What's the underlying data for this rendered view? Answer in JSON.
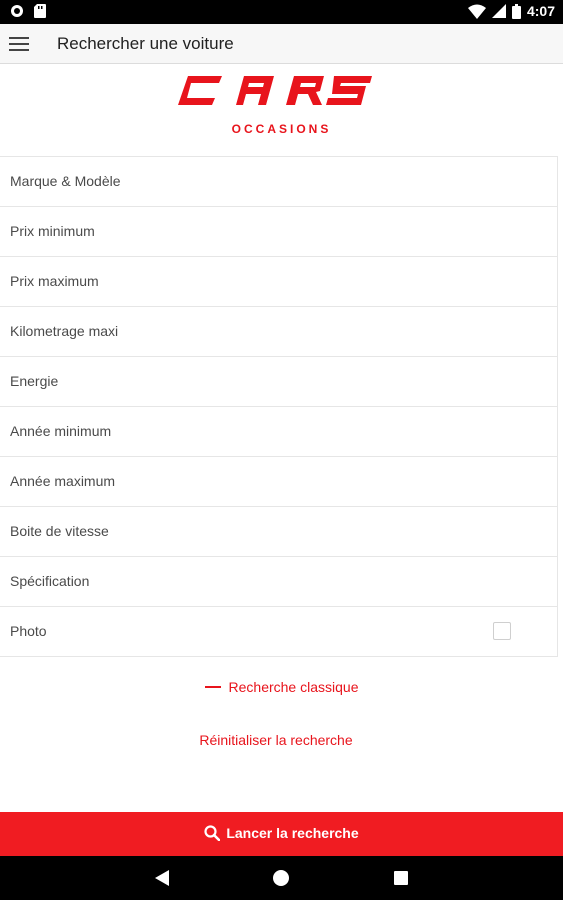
{
  "status_bar": {
    "time": "4:07",
    "icons": [
      "sync-icon",
      "sd-card-icon",
      "wifi-icon",
      "signal-icon",
      "battery-icon"
    ]
  },
  "app_bar": {
    "title": "Rechercher une voiture",
    "menu_icon": "hamburger-menu-icon"
  },
  "logo": {
    "brand": "CARS",
    "subtitle": "OCCASIONS",
    "color": "#e8141c"
  },
  "fields": [
    {
      "label": "Marque & Modèle"
    },
    {
      "label": "Prix minimum"
    },
    {
      "label": "Prix maximum"
    },
    {
      "label": "Kilometrage maxi"
    },
    {
      "label": "Energie"
    },
    {
      "label": "Année minimum"
    },
    {
      "label": "Année maximum"
    },
    {
      "label": "Boite de vitesse"
    },
    {
      "label": "Spécification"
    },
    {
      "label": "Photo",
      "checked": false
    }
  ],
  "links": {
    "classic": "Recherche classique",
    "reset": "Réinitialiser la recherche"
  },
  "search_button": {
    "label": "Lancer la recherche",
    "icon": "search-icon",
    "color": "#f01c22"
  },
  "nav_bar": {
    "icons": [
      "back-icon",
      "home-icon",
      "recents-icon"
    ]
  }
}
